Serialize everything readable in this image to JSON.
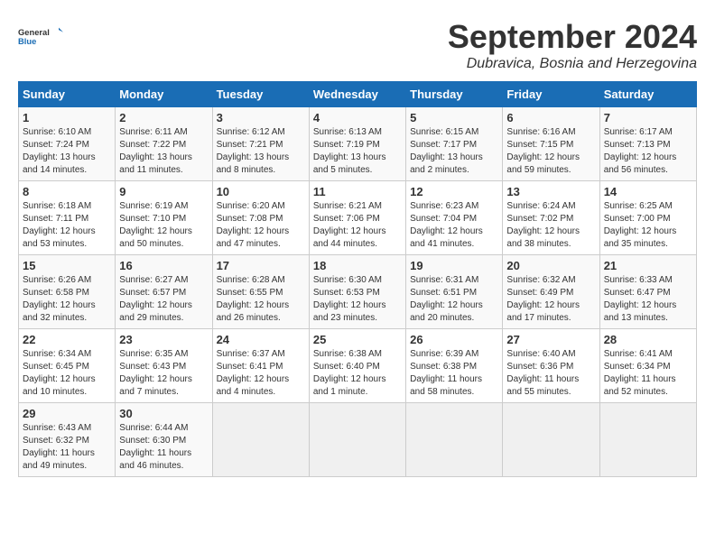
{
  "header": {
    "logo_line1": "General",
    "logo_line2": "Blue",
    "month": "September 2024",
    "location": "Dubravica, Bosnia and Herzegovina"
  },
  "weekdays": [
    "Sunday",
    "Monday",
    "Tuesday",
    "Wednesday",
    "Thursday",
    "Friday",
    "Saturday"
  ],
  "weeks": [
    [
      {
        "day": "1",
        "info": "Sunrise: 6:10 AM\nSunset: 7:24 PM\nDaylight: 13 hours\nand 14 minutes."
      },
      {
        "day": "2",
        "info": "Sunrise: 6:11 AM\nSunset: 7:22 PM\nDaylight: 13 hours\nand 11 minutes."
      },
      {
        "day": "3",
        "info": "Sunrise: 6:12 AM\nSunset: 7:21 PM\nDaylight: 13 hours\nand 8 minutes."
      },
      {
        "day": "4",
        "info": "Sunrise: 6:13 AM\nSunset: 7:19 PM\nDaylight: 13 hours\nand 5 minutes."
      },
      {
        "day": "5",
        "info": "Sunrise: 6:15 AM\nSunset: 7:17 PM\nDaylight: 13 hours\nand 2 minutes."
      },
      {
        "day": "6",
        "info": "Sunrise: 6:16 AM\nSunset: 7:15 PM\nDaylight: 12 hours\nand 59 minutes."
      },
      {
        "day": "7",
        "info": "Sunrise: 6:17 AM\nSunset: 7:13 PM\nDaylight: 12 hours\nand 56 minutes."
      }
    ],
    [
      {
        "day": "8",
        "info": "Sunrise: 6:18 AM\nSunset: 7:11 PM\nDaylight: 12 hours\nand 53 minutes."
      },
      {
        "day": "9",
        "info": "Sunrise: 6:19 AM\nSunset: 7:10 PM\nDaylight: 12 hours\nand 50 minutes."
      },
      {
        "day": "10",
        "info": "Sunrise: 6:20 AM\nSunset: 7:08 PM\nDaylight: 12 hours\nand 47 minutes."
      },
      {
        "day": "11",
        "info": "Sunrise: 6:21 AM\nSunset: 7:06 PM\nDaylight: 12 hours\nand 44 minutes."
      },
      {
        "day": "12",
        "info": "Sunrise: 6:23 AM\nSunset: 7:04 PM\nDaylight: 12 hours\nand 41 minutes."
      },
      {
        "day": "13",
        "info": "Sunrise: 6:24 AM\nSunset: 7:02 PM\nDaylight: 12 hours\nand 38 minutes."
      },
      {
        "day": "14",
        "info": "Sunrise: 6:25 AM\nSunset: 7:00 PM\nDaylight: 12 hours\nand 35 minutes."
      }
    ],
    [
      {
        "day": "15",
        "info": "Sunrise: 6:26 AM\nSunset: 6:58 PM\nDaylight: 12 hours\nand 32 minutes."
      },
      {
        "day": "16",
        "info": "Sunrise: 6:27 AM\nSunset: 6:57 PM\nDaylight: 12 hours\nand 29 minutes."
      },
      {
        "day": "17",
        "info": "Sunrise: 6:28 AM\nSunset: 6:55 PM\nDaylight: 12 hours\nand 26 minutes."
      },
      {
        "day": "18",
        "info": "Sunrise: 6:30 AM\nSunset: 6:53 PM\nDaylight: 12 hours\nand 23 minutes."
      },
      {
        "day": "19",
        "info": "Sunrise: 6:31 AM\nSunset: 6:51 PM\nDaylight: 12 hours\nand 20 minutes."
      },
      {
        "day": "20",
        "info": "Sunrise: 6:32 AM\nSunset: 6:49 PM\nDaylight: 12 hours\nand 17 minutes."
      },
      {
        "day": "21",
        "info": "Sunrise: 6:33 AM\nSunset: 6:47 PM\nDaylight: 12 hours\nand 13 minutes."
      }
    ],
    [
      {
        "day": "22",
        "info": "Sunrise: 6:34 AM\nSunset: 6:45 PM\nDaylight: 12 hours\nand 10 minutes."
      },
      {
        "day": "23",
        "info": "Sunrise: 6:35 AM\nSunset: 6:43 PM\nDaylight: 12 hours\nand 7 minutes."
      },
      {
        "day": "24",
        "info": "Sunrise: 6:37 AM\nSunset: 6:41 PM\nDaylight: 12 hours\nand 4 minutes."
      },
      {
        "day": "25",
        "info": "Sunrise: 6:38 AM\nSunset: 6:40 PM\nDaylight: 12 hours\nand 1 minute."
      },
      {
        "day": "26",
        "info": "Sunrise: 6:39 AM\nSunset: 6:38 PM\nDaylight: 11 hours\nand 58 minutes."
      },
      {
        "day": "27",
        "info": "Sunrise: 6:40 AM\nSunset: 6:36 PM\nDaylight: 11 hours\nand 55 minutes."
      },
      {
        "day": "28",
        "info": "Sunrise: 6:41 AM\nSunset: 6:34 PM\nDaylight: 11 hours\nand 52 minutes."
      }
    ],
    [
      {
        "day": "29",
        "info": "Sunrise: 6:43 AM\nSunset: 6:32 PM\nDaylight: 11 hours\nand 49 minutes."
      },
      {
        "day": "30",
        "info": "Sunrise: 6:44 AM\nSunset: 6:30 PM\nDaylight: 11 hours\nand 46 minutes."
      },
      {
        "day": "",
        "info": ""
      },
      {
        "day": "",
        "info": ""
      },
      {
        "day": "",
        "info": ""
      },
      {
        "day": "",
        "info": ""
      },
      {
        "day": "",
        "info": ""
      }
    ]
  ]
}
